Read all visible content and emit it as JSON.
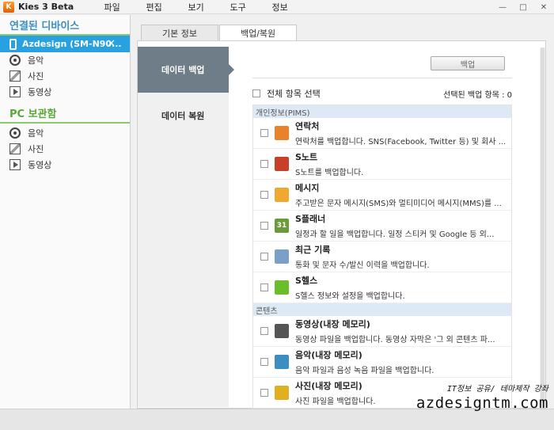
{
  "window": {
    "title": "Kies 3 Beta",
    "logo_text": "K",
    "minimize": "—",
    "maximize": "□",
    "close": "✕"
  },
  "menu": [
    "파일",
    "편집",
    "보기",
    "도구",
    "정보"
  ],
  "sidebar": {
    "connected_header": "연결된 디바이스",
    "device_name": "Azdesign (SM-N90...",
    "device_close": "✕",
    "device_items": [
      "음악",
      "사진",
      "동영상"
    ],
    "pc_header": "PC 보관함",
    "pc_items": [
      "음악",
      "사진",
      "동영상"
    ]
  },
  "tabs": [
    "기본 정보",
    "백업/복원"
  ],
  "subnav": [
    "데이터 백업",
    "데이터 복원"
  ],
  "actions": {
    "backup_button": "백업",
    "select_all": "전체 항목 선택",
    "selected_count": "선택된 백업 항목 : 0"
  },
  "categories": [
    {
      "label": "개인정보(PIMS)",
      "items": [
        {
          "title": "연락처",
          "desc": "연락처를 백업합니다. SNS(Facebook, Twitter 등) 및 회사 ...",
          "icon": "contacts-icon",
          "color": "#e8832a"
        },
        {
          "title": "S노트",
          "desc": "S노트를 백업합니다.",
          "icon": "snote-icon",
          "color": "#c8402a"
        },
        {
          "title": "메시지",
          "desc": "주고받은 문자 메시지(SMS)와 멀티미디어 메시지(MMS)를 ...",
          "icon": "message-icon",
          "color": "#f0a830"
        },
        {
          "title": "S플래너",
          "desc": "일정과 할 일을 백업합니다. 일정 스티커 및 Google 등 외...",
          "icon": "calendar-icon",
          "color": "#6a9a3a",
          "icon_text": "31"
        },
        {
          "title": "최근 기록",
          "desc": "통화 및 문자 수/발신 이력을 백업합니다.",
          "icon": "call-log-icon",
          "color": "#7aa0c8"
        },
        {
          "title": "S헬스",
          "desc": "S헬스 정보와 설정을 백업합니다.",
          "icon": "shealth-icon",
          "color": "#6abe2a"
        }
      ]
    },
    {
      "label": "콘텐츠",
      "items": [
        {
          "title": "동영상(내장 메모리)",
          "desc": "동영상 파일을 백업합니다. 동영상 자막은 '그 외 콘텐츠 파...",
          "icon": "video-file-icon",
          "color": "#555555"
        },
        {
          "title": "음악(내장 메모리)",
          "desc": "음악 파일과 음성 녹음 파일을 백업합니다.",
          "icon": "music-file-icon",
          "color": "#3a8fc0"
        },
        {
          "title": "사진(내장 메모리)",
          "desc": "사진 파일을 백업합니다.",
          "icon": "photo-file-icon",
          "color": "#e0b020"
        }
      ]
    }
  ],
  "watermark": {
    "line1": "IT정보 공유/ 테마제작 강좌",
    "line2": "azdesigntm.com"
  }
}
